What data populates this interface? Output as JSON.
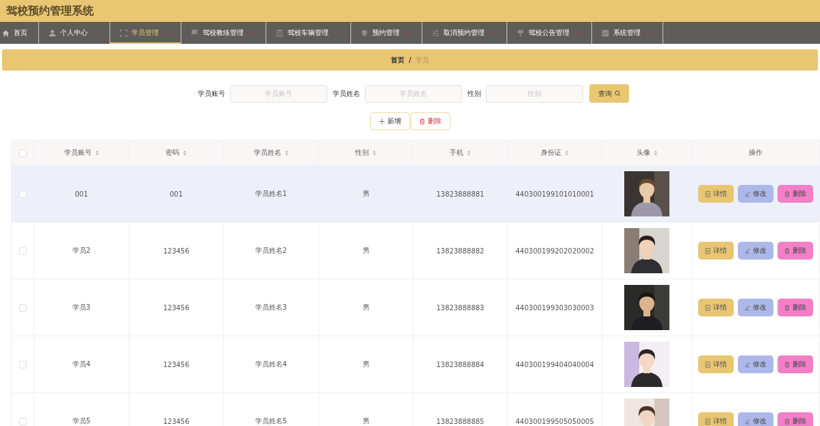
{
  "header": {
    "title": "驾校预约管理系统"
  },
  "nav": [
    {
      "label": "首页",
      "has_menu": false,
      "selected": false
    },
    {
      "label": "个人中心",
      "has_menu": true,
      "selected": false
    },
    {
      "label": "学员管理",
      "has_menu": true,
      "selected": true
    },
    {
      "label": "驾校教练管理",
      "has_menu": true,
      "selected": false
    },
    {
      "label": "驾校车辆管理",
      "has_menu": true,
      "selected": false
    },
    {
      "label": "预约管理",
      "has_menu": true,
      "selected": false
    },
    {
      "label": "取消预约管理",
      "has_menu": true,
      "selected": false
    },
    {
      "label": "驾校公告管理",
      "has_menu": true,
      "selected": false
    },
    {
      "label": "系统管理",
      "has_menu": true,
      "selected": false
    }
  ],
  "breadcrumb": {
    "home": "首页",
    "separator": "/",
    "current": "学员"
  },
  "search": {
    "fields": [
      {
        "label": "学员账号",
        "placeholder": "学员账号"
      },
      {
        "label": "学员姓名",
        "placeholder": "学员姓名"
      },
      {
        "label": "性别",
        "placeholder": "性别"
      }
    ],
    "button": "查询"
  },
  "actions": {
    "add": "新增",
    "delete": "删除"
  },
  "table": {
    "header_checked": false,
    "columns": [
      {
        "label": "学员账号",
        "sortable": true
      },
      {
        "label": "密码",
        "sortable": true
      },
      {
        "label": "学员姓名",
        "sortable": true
      },
      {
        "label": "性别",
        "sortable": true
      },
      {
        "label": "手机",
        "sortable": true
      },
      {
        "label": "身份证",
        "sortable": true
      },
      {
        "label": "头像",
        "sortable": true
      },
      {
        "label": "操作",
        "sortable": false
      }
    ],
    "rows": [
      {
        "checked": false,
        "highlighted": true,
        "cells": [
          "001",
          "001",
          "学员姓名1",
          "男",
          "13823888881",
          "440300199101010001"
        ],
        "buttons": [
          "详情",
          "修改",
          "删除"
        ]
      },
      {
        "checked": false,
        "highlighted": false,
        "cells": [
          "学员2",
          "123456",
          "学员姓名2",
          "男",
          "13823888882",
          "440300199202020002"
        ],
        "buttons": [
          "详情",
          "修改",
          "删除"
        ]
      },
      {
        "checked": false,
        "highlighted": false,
        "cells": [
          "学员3",
          "123456",
          "学员姓名3",
          "男",
          "13823888883",
          "440300199303030003"
        ],
        "buttons": [
          "详情",
          "修改",
          "删除"
        ]
      },
      {
        "checked": false,
        "highlighted": false,
        "cells": [
          "学员4",
          "123456",
          "学员姓名4",
          "男",
          "13823888884",
          "440300199404040004"
        ],
        "buttons": [
          "详情",
          "修改",
          "删除"
        ]
      },
      {
        "checked": false,
        "highlighted": false,
        "cells": [
          "学员5",
          "123456",
          "学员姓名5",
          "男",
          "13823888885",
          "440300199505050005"
        ],
        "buttons": [
          "详情",
          "修改",
          "删除"
        ]
      }
    ]
  }
}
